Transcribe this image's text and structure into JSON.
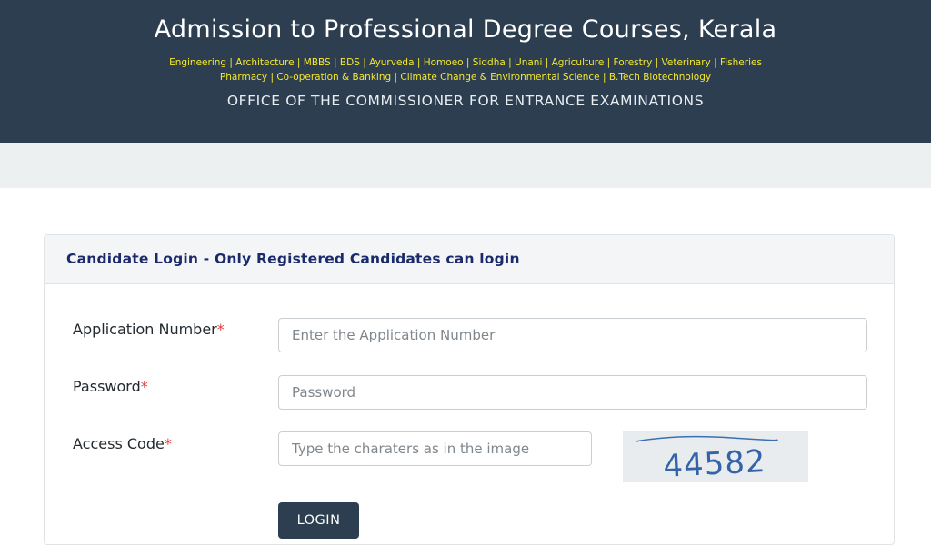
{
  "header": {
    "title": "Admission to Professional Degree Courses, Kerala",
    "courses_line1": "Engineering | Architecture | MBBS | BDS | Ayurveda | Homoeo | Siddha | Unani | Agriculture | Forestry | Veterinary | Fisheries",
    "courses_line2": "Pharmacy | Co-operation & Banking | Climate Change & Environmental Science | B.Tech Biotechnology",
    "office": "OFFICE OF THE COMMISSIONER FOR ENTRANCE EXAMINATIONS",
    "colors": {
      "background": "#2c3e50",
      "courses_text": "#f5e92c"
    }
  },
  "login_card": {
    "title": "Candidate Login - Only Registered Candidates can login",
    "required_marker": "*",
    "fields": {
      "application_number": {
        "label": "Application Number",
        "placeholder": "Enter the Application Number",
        "value": ""
      },
      "password": {
        "label": "Password",
        "placeholder": "Password",
        "value": ""
      },
      "access_code": {
        "label": "Access Code",
        "placeholder": "Type the charaters as in the image",
        "value": ""
      }
    },
    "captcha_text": "44582",
    "login_button": "LOGIN"
  }
}
